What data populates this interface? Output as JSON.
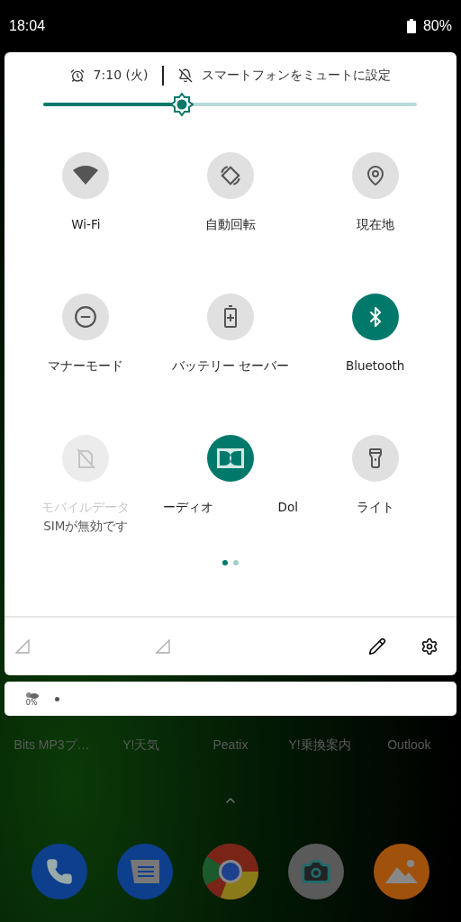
{
  "status_bar": {
    "time": "18:04",
    "battery": "80%"
  },
  "quick_settings": {
    "alarm": "7:10 (火)",
    "ringer": "スマートフォンをミュートに設定",
    "brightness": {
      "level": 0.37
    },
    "tiles": [
      {
        "kind": "wifi",
        "label": "Wi-Fi",
        "on": false,
        "disabled": false
      },
      {
        "kind": "rotate",
        "label": "自動回転",
        "on": false,
        "disabled": false
      },
      {
        "kind": "location",
        "label": "現在地",
        "on": false,
        "disabled": false
      },
      {
        "kind": "dnd",
        "label": "マナーモード",
        "on": false,
        "disabled": false
      },
      {
        "kind": "battery",
        "label": "バッテリー セーバー",
        "on": false,
        "disabled": false
      },
      {
        "kind": "bluetooth",
        "label": "Bluetooth",
        "on": true,
        "disabled": false
      },
      {
        "kind": "mobile",
        "label": "モバイルデータ",
        "sublabel": "SIMが無効です",
        "on": false,
        "disabled": true
      },
      {
        "kind": "dolby",
        "label": "ーディオ",
        "label_2": "Dol",
        "on": true,
        "disabled": false
      },
      {
        "kind": "flashlight",
        "label": "ライト",
        "on": false,
        "disabled": false
      }
    ],
    "pages": [
      {
        "selected": true
      },
      {
        "selected": false
      }
    ]
  },
  "notification": {
    "weather": "0%"
  },
  "home": {
    "apps": [
      "Bits MP3プ…",
      "Y!天気",
      "Peatix",
      "Y!乗換案内",
      "Outlook"
    ],
    "dock": [
      {
        "kind": "phone"
      },
      {
        "kind": "messages"
      },
      {
        "kind": "browser"
      },
      {
        "kind": "camera"
      },
      {
        "kind": "gallery"
      }
    ]
  }
}
